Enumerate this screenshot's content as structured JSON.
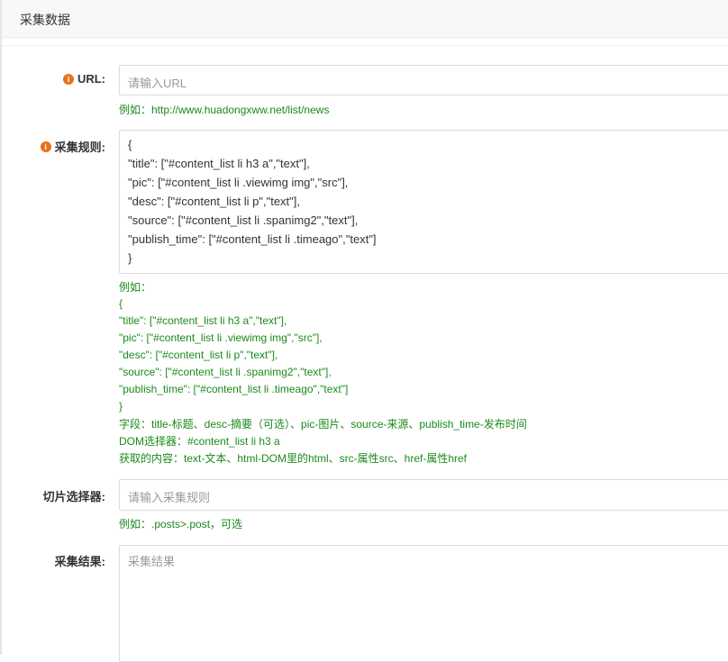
{
  "header": {
    "title": "采集数据"
  },
  "form": {
    "url": {
      "label": "URL:",
      "placeholder": "请输入URL",
      "hint": "例如：http://www.huadongxww.net/list/news"
    },
    "rules": {
      "label": "采集规则:",
      "value_lines": [
        "{",
        "\"title\": [\"#content_list li h3 a\",\"text\"],",
        "\"pic\": [\"#content_list li .viewimg img\",\"src\"],",
        "\"desc\": [\"#content_list li p\",\"text\"],",
        "\"source\": [\"#content_list li .spanimg2\",\"text\"],",
        "\"publish_time\": [\"#content_list li .timeago\",\"text\"]",
        "}"
      ],
      "help_lines": [
        "例如：",
        "{",
        "\"title\": [\"#content_list li h3 a\",\"text\"],",
        "\"pic\": [\"#content_list li .viewimg img\",\"src\"],",
        "\"desc\": [\"#content_list li p\",\"text\"],",
        "\"source\": [\"#content_list li .spanimg2\",\"text\"],",
        "\"publish_time\": [\"#content_list li .timeago\",\"text\"]",
        "}",
        "字段：title-标题、desc-摘要（可选）、pic-图片、source-来源、publish_time-发布时间",
        "DOM选择器：#content_list li h3 a",
        "获取的内容：text-文本、html-DOM里的html、src-属性src、href-属性href"
      ]
    },
    "slice": {
      "label": "切片选择器:",
      "placeholder": "请输入采集规则",
      "hint": "例如：.posts>.post，可选"
    },
    "result": {
      "label": "采集结果:",
      "placeholder": "采集结果"
    }
  },
  "colors": {
    "hint_green": "#1a8a1a",
    "info_orange": "#e8711c"
  },
  "icons": {
    "required": "info-circle-icon"
  }
}
